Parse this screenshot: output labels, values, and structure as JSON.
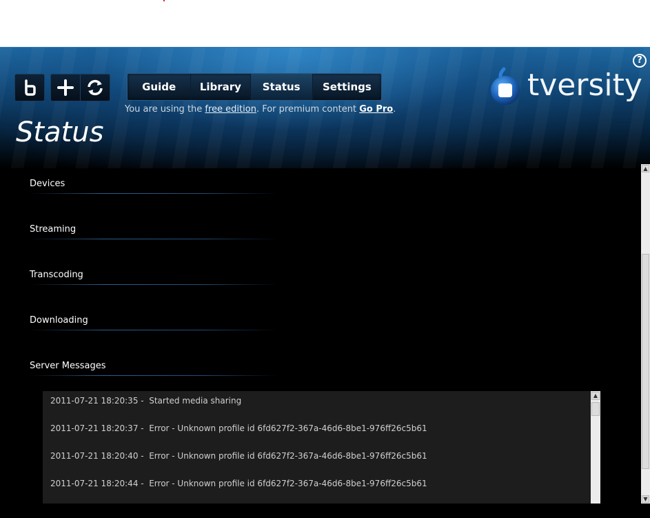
{
  "toolbar": {
    "buttons": [
      {
        "icon": "tv-logo-icon"
      },
      {
        "icon": "plus-icon"
      },
      {
        "icon": "refresh-icon"
      }
    ]
  },
  "nav": {
    "tabs": [
      "Guide",
      "Library",
      "Status",
      "Settings"
    ],
    "active": "Status"
  },
  "edition": {
    "prefix": "You are using the ",
    "free_link": "free edition",
    "middle": ". For premium content ",
    "pro_link": "Go Pro",
    "suffix": "."
  },
  "page": {
    "title": "Status"
  },
  "logo": {
    "text": "tversity"
  },
  "help": {
    "label": "?"
  },
  "sections": [
    "Devices",
    "Streaming",
    "Transcoding",
    "Downloading",
    "Server Messages"
  ],
  "messages": [
    "2011-07-21 18:20:35 -  Started media sharing",
    "2011-07-21 18:20:37 -  Error - Unknown profile id 6fd627f2-367a-46d6-8be1-976ff26c5b61",
    "2011-07-21 18:20:40 -  Error - Unknown profile id 6fd627f2-367a-46d6-8be1-976ff26c5b61",
    "2011-07-21 18:20:44 -  Error - Unknown profile id 6fd627f2-367a-46d6-8be1-976ff26c5b61"
  ],
  "colors": {
    "accent": "#1f6aa3",
    "background": "#000000",
    "panel": "#1d1d1d"
  }
}
